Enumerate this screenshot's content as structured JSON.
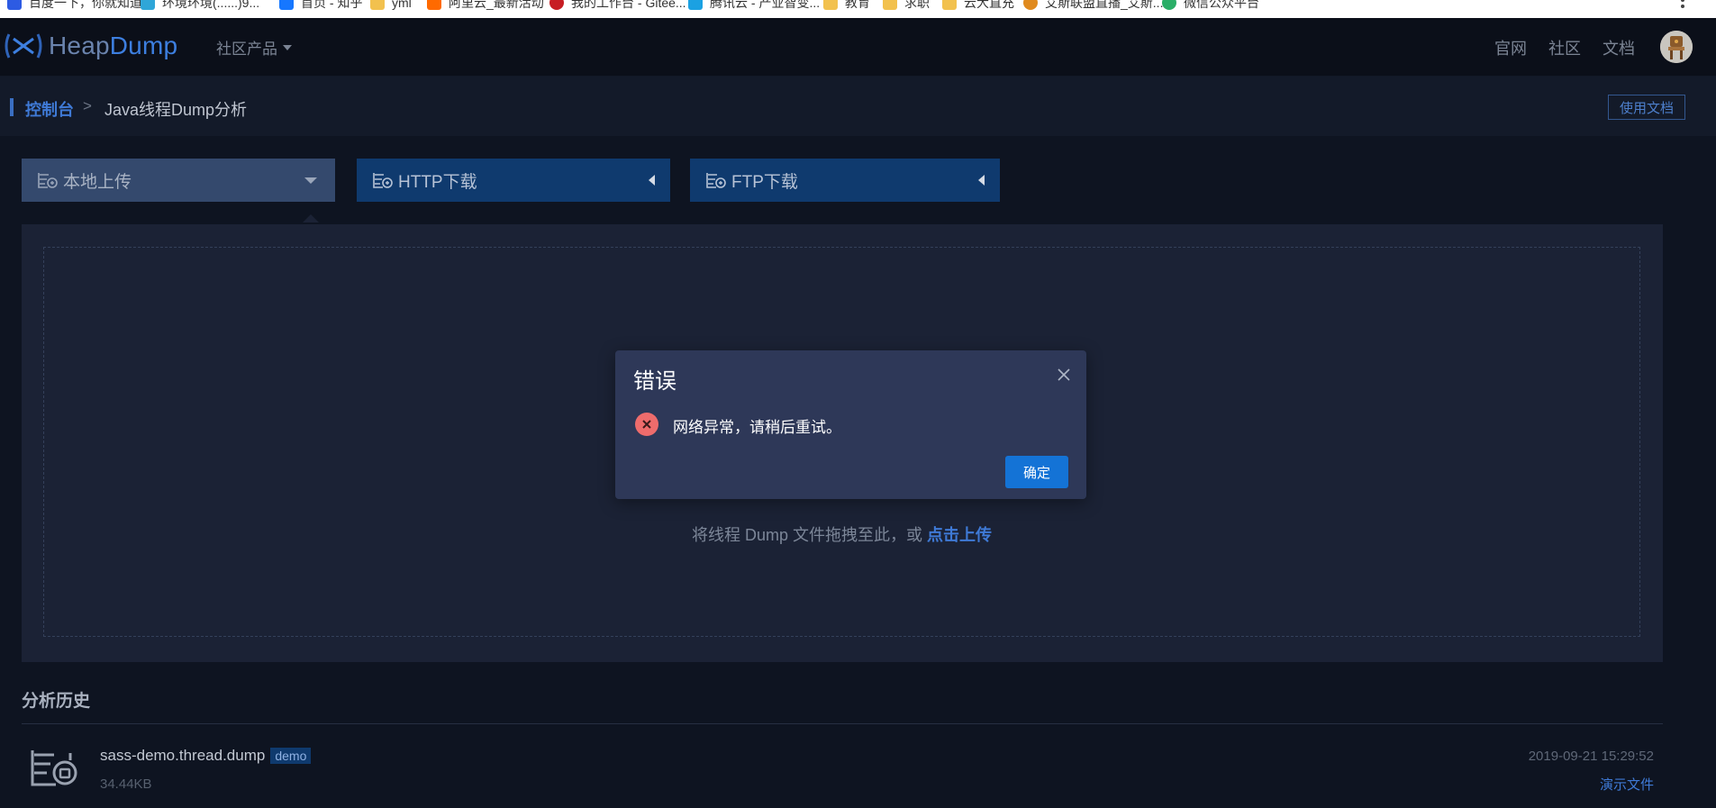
{
  "bookmarks": [
    {
      "label": "百度一下，你就知道",
      "color": "#2d5be3"
    },
    {
      "label": "环境环境(......)9...",
      "color": "#2fa6d8"
    },
    {
      "label": "首页 - 知乎",
      "color": "#1677ff"
    },
    {
      "label": "yml",
      "color": "#f2c14e"
    },
    {
      "label": "阿里云_最新活动",
      "color": "#ff6a00"
    },
    {
      "label": "我的工作台 - Gitee...",
      "color": "#c71d23"
    },
    {
      "label": "腾讯云 - 产业智变...",
      "color": "#1ba1e2"
    },
    {
      "label": "教育",
      "color": "#f2c14e"
    },
    {
      "label": "求职",
      "color": "#f2c14e"
    },
    {
      "label": "云大直充",
      "color": "#f2c14e"
    },
    {
      "label": "艾斯联盟直播_艾斯...",
      "color": "#e08a1e"
    },
    {
      "label": "微信公众平台",
      "color": "#2aae67"
    }
  ],
  "header": {
    "logo_heap": "Heap",
    "logo_dump": "Dump",
    "products_menu": "社区产品",
    "nav": [
      "官网",
      "社区",
      "文档"
    ]
  },
  "breadcrumb": {
    "home": "控制台",
    "separator": ">",
    "current": "Java线程Dump分析",
    "doc_button": "使用文档"
  },
  "tabs": [
    {
      "label": "本地上传",
      "active": true
    },
    {
      "label": "HTTP下载",
      "active": false
    },
    {
      "label": "FTP下载",
      "active": false
    }
  ],
  "upload": {
    "hint": "将线程 Dump 文件拖拽至此，或 ",
    "link": "点击上传"
  },
  "history": {
    "title": "分析历史",
    "items": [
      {
        "filename": "sass-demo.thread.dump",
        "badge": "demo",
        "size": "34.44KB",
        "time": "2019-09-21 15:29:52",
        "link": "演示文件"
      }
    ]
  },
  "modal": {
    "title": "错误",
    "message": "网络异常，请稍后重试。",
    "ok_label": "确定"
  },
  "colors": {
    "accent": "#3f7ad6",
    "primary_button": "#1473d6",
    "error": "#ee6c6c",
    "background": "#0e1421"
  }
}
